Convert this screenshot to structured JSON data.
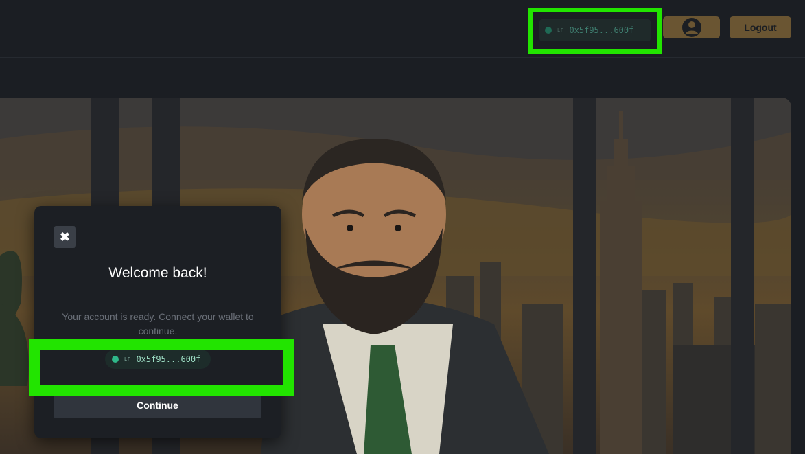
{
  "header": {
    "wallet_tag": "LF",
    "wallet_address": "0x5f95...600f",
    "account_icon": "user-circle-icon",
    "logout_label": "Logout"
  },
  "hero": {
    "image": "illustration-businessman-in-city-office"
  },
  "modal": {
    "close_icon": "close-icon",
    "close_glyph": "✖",
    "title": "Welcome back!",
    "subtitle": "Your account is ready. Connect your wallet to continue.",
    "wallet_tag": "LF",
    "wallet_address": "0x5f95...600f",
    "continue_label": "Continue"
  },
  "colors": {
    "background": "#1b1e23",
    "accent_gold": "#6a5532",
    "wallet_green": "#2fb88a",
    "highlight_green": "#22e400"
  }
}
